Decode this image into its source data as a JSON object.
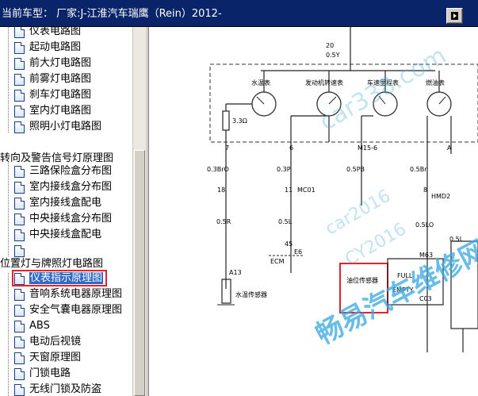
{
  "titlebar": {
    "title": "当前车型： 厂家:J-江淮汽车瑞鹰（Rein）2012-"
  },
  "tree": {
    "top_item": "仪表电路图",
    "group1_items": [
      "起动电路图",
      "前大灯电路图",
      "前雾灯电路图",
      "刹车灯电路图",
      "室内灯电路图",
      "照明小灯电路图"
    ],
    "group2": "转向及警告信号灯原理图",
    "group2_items": [
      "三路保险盒分布图",
      "室内接线盒分布图",
      "室内接线盒配电",
      "中央接线盒分布图",
      "中央接线盒配电",
      ""
    ],
    "group3": "位置灯与牌照灯电路图",
    "selected_item": "仪表指示原理图",
    "group3_items": [
      "音响系统电器原理图",
      "安全气囊电器原理图",
      "ABS",
      "电动后视镜",
      "天窗原理图",
      "门锁电路",
      "无线门锁及防盗"
    ]
  },
  "diagram": {
    "labels": {
      "water_temp": "水温表",
      "tacho": "发动机转速表",
      "speedo": "车速里程表",
      "fuel_gauge": "燃油表",
      "resistor": "3.3Ω",
      "pin7": "7",
      "pin6": "6",
      "pinM15": "M15-6",
      "pinA": "A",
      "wire1": "0.3BrO",
      "wire2": "0.3P",
      "wire3": "0.5PB",
      "wire4": "0.5Br",
      "pin18": "18",
      "pinMC01": "MC01",
      "pinHMD2": "HMD2",
      "pin11": "11",
      "pin8": "8",
      "wire5": "0.5R",
      "wire6": "0.5L",
      "wire7": "0.5LO",
      "wire8": "0.5L",
      "ecm": "ECM",
      "pin45": "45",
      "ecm_conn": "E6",
      "a13": "A13",
      "water_sensor": "水温传感器",
      "fuel_sensor": "油位传感器",
      "full": "FULL",
      "empty": "EMPTY",
      "m63": "M63",
      "c03": "C03",
      "top_wire": "0.5Y",
      "top_pin": "20"
    },
    "watermarks": [
      "car338.com",
      "畅易汽车维修",
      "car2016",
      "CY2016",
      "畅易汽车维修网"
    ]
  }
}
